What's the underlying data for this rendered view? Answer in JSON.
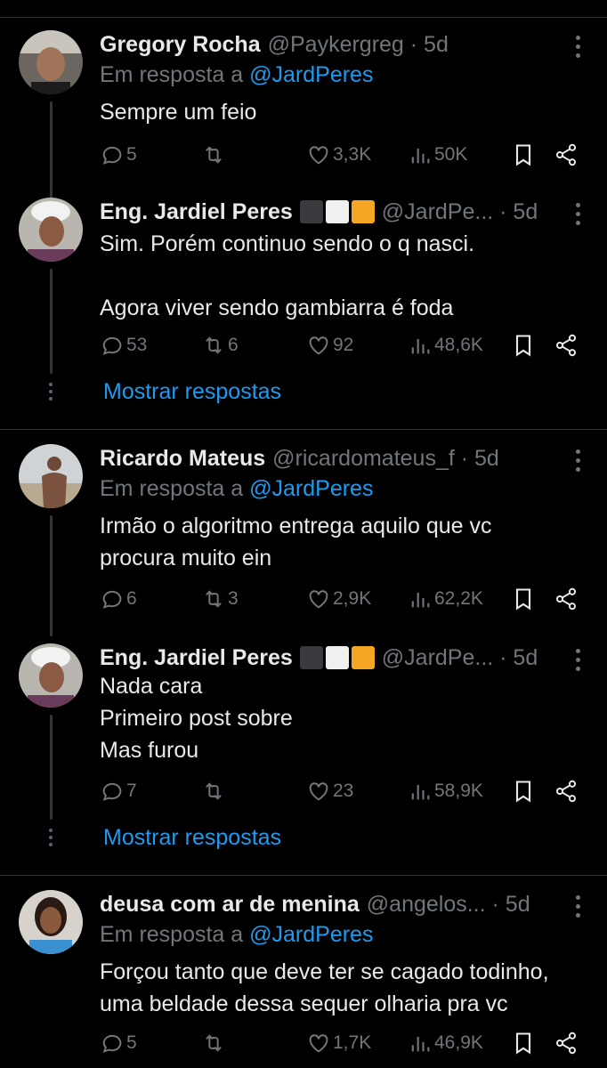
{
  "tweets": [
    {
      "name": "Gregory Rocha",
      "handle": "@Paykergreg · 5d",
      "reply_prefix": "Em resposta a",
      "reply_mention": "@JardPeres",
      "text_lines": [
        "Sempre um feio"
      ],
      "replies": "5",
      "retweets": "",
      "likes": "3,3K",
      "views": "50K"
    },
    {
      "name": "Eng. Jardiel Peres",
      "flags": [
        "#3a3a3e",
        "#f0f0f0",
        "#f5a623"
      ],
      "handle": "@JardPe... · 5d",
      "text_lines": [
        "Sim. Porém continuo sendo o q nasci.",
        "",
        "Agora viver sendo gambiarra é foda"
      ],
      "replies": "53",
      "retweets": "6",
      "likes": "92",
      "views": "48,6K",
      "show_replies": "Mostrar respostas"
    },
    {
      "name": "Ricardo Mateus",
      "handle": "@ricardomateus_f · 5d",
      "reply_prefix": "Em resposta a",
      "reply_mention": "@JardPeres",
      "text_lines": [
        "Irmão o algoritmo entrega aquilo que vc",
        "procura muito ein"
      ],
      "replies": "6",
      "retweets": "3",
      "likes": "2,9K",
      "views": "62,2K"
    },
    {
      "name": "Eng. Jardiel Peres",
      "flags": [
        "#3a3a3e",
        "#f0f0f0",
        "#f5a623"
      ],
      "handle": "@JardPe... · 5d",
      "text_lines": [
        "Nada cara",
        "Primeiro post sobre",
        "Mas furou"
      ],
      "replies": "7",
      "retweets": "",
      "likes": "23",
      "views": "58,9K",
      "show_replies": "Mostrar respostas"
    },
    {
      "name": "deusa com ar de menina",
      "handle": "@angelos... · 5d",
      "reply_prefix": "Em resposta a",
      "reply_mention": "@JardPeres",
      "text_lines": [
        "Forçou tanto que deve ter se cagado todinho,",
        "uma beldade dessa sequer olharia pra vc"
      ],
      "replies": "5",
      "retweets": "",
      "likes": "1,7K",
      "views": "46,9K"
    }
  ],
  "colors": {
    "accent": "#1d9bf0",
    "muted": "#71767b",
    "text": "#e7e9ea",
    "divider": "#2f3336"
  },
  "icons": {
    "reply": "reply-icon",
    "retweet": "retweet-icon",
    "like": "heart-icon",
    "views": "views-icon",
    "bookmark": "bookmark-icon",
    "share": "share-icon",
    "more": "more-icon"
  }
}
